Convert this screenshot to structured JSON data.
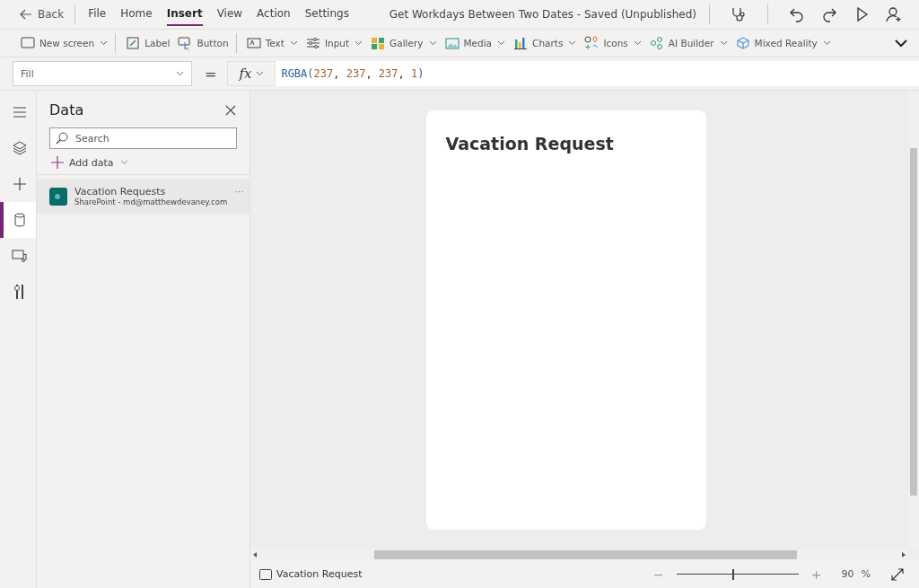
{
  "menu": {
    "back": "Back",
    "items": [
      {
        "label": "File",
        "selected": false
      },
      {
        "label": "Home",
        "selected": false
      },
      {
        "label": "Insert",
        "selected": true
      },
      {
        "label": "View",
        "selected": false
      },
      {
        "label": "Action",
        "selected": false
      },
      {
        "label": "Settings",
        "selected": false
      }
    ],
    "title": "Get Workdays Between Two Dates - Saved (Unpublished)"
  },
  "toolbar": [
    {
      "label": "New screen",
      "dropdown": true,
      "divider": true
    },
    {
      "label": "Label",
      "dropdown": false,
      "divider": false
    },
    {
      "label": "Button",
      "dropdown": false,
      "divider": true
    },
    {
      "label": "Text",
      "dropdown": true,
      "divider": false
    },
    {
      "label": "Input",
      "dropdown": true,
      "divider": false
    },
    {
      "label": "Gallery",
      "dropdown": true,
      "divider": false
    },
    {
      "label": "Media",
      "dropdown": true,
      "divider": false
    },
    {
      "label": "Charts",
      "dropdown": true,
      "divider": false
    },
    {
      "label": "Icons",
      "dropdown": true,
      "divider": false
    },
    {
      "label": "AI Builder",
      "dropdown": true,
      "divider": false
    },
    {
      "label": "Mixed Reality",
      "dropdown": true,
      "divider": false
    }
  ],
  "formula": {
    "property": "Fill",
    "equals": "=",
    "fx": "fx",
    "tokens": [
      {
        "text": "RGBA(",
        "kind": "func"
      },
      {
        "text": "237",
        "kind": "number"
      },
      {
        "text": ", ",
        "kind": "punct"
      },
      {
        "text": "237",
        "kind": "number"
      },
      {
        "text": ", ",
        "kind": "punct"
      },
      {
        "text": "237",
        "kind": "number"
      },
      {
        "text": ", ",
        "kind": "punct"
      },
      {
        "text": "1",
        "kind": "number"
      },
      {
        "text": ")",
        "kind": "func"
      }
    ]
  },
  "rail": [
    {
      "selected": false
    },
    {
      "selected": false
    },
    {
      "selected": false
    },
    {
      "selected": true
    },
    {
      "selected": false
    },
    {
      "selected": false
    }
  ],
  "data_panel": {
    "title": "Data",
    "search": {
      "placeholder": "Search"
    },
    "add_data": "Add data",
    "sources": [
      {
        "name": "Vacation Requests",
        "detail": "SharePoint - md@matthewdevaney.com",
        "more": "···"
      }
    ]
  },
  "canvas": {
    "screen_title": "Vacation Request"
  },
  "status_bar": {
    "screen": "Vacation Request",
    "zoom_minus": "−",
    "zoom_plus": "+",
    "zoom": {
      "level": 0.46
    },
    "zoom_value": "90",
    "zoom_unit": "%"
  }
}
